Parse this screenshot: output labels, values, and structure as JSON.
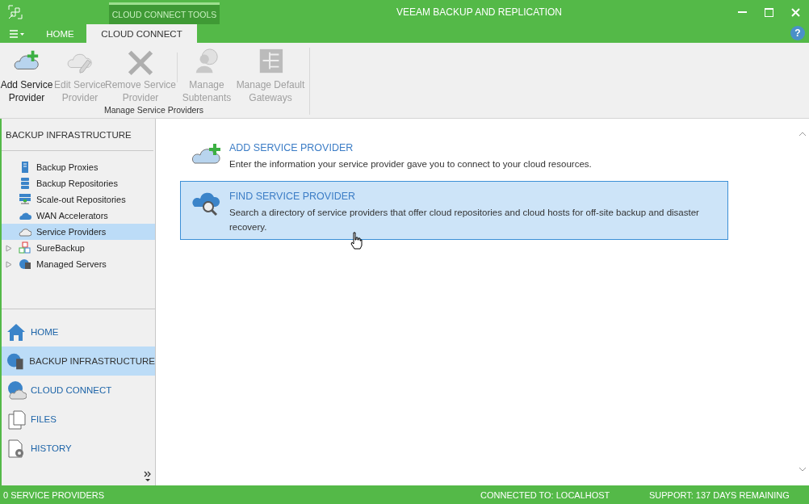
{
  "window": {
    "title": "VEEAM BACKUP AND REPLICATION",
    "context_tab": "CLOUD CONNECT TOOLS"
  },
  "tabs": [
    {
      "label": "HOME",
      "selected": false
    },
    {
      "label": "CLOUD CONNECT",
      "selected": true
    }
  ],
  "ribbon": {
    "groups": [
      {
        "label": "Manage Service Providers",
        "buttons": [
          {
            "label": "Add Service Provider",
            "disabled": false
          },
          {
            "label": "Edit Service Provider",
            "disabled": true
          },
          {
            "label": "Remove Service Provider",
            "disabled": true
          },
          {
            "label": "Manage Subtenants",
            "disabled": true
          },
          {
            "label": "Manage Default Gateways",
            "disabled": true
          }
        ]
      }
    ]
  },
  "sidebar": {
    "title": "BACKUP INFRASTRUCTURE",
    "items": [
      {
        "label": "Backup Proxies",
        "expandable": false,
        "selected": false
      },
      {
        "label": "Backup Repositories",
        "expandable": false,
        "selected": false
      },
      {
        "label": "Scale-out Repositories",
        "expandable": false,
        "selected": false
      },
      {
        "label": "WAN Accelerators",
        "expandable": false,
        "selected": false
      },
      {
        "label": "Service Providers",
        "expandable": false,
        "selected": true
      },
      {
        "label": "SureBackup",
        "expandable": true,
        "selected": false
      },
      {
        "label": "Managed Servers",
        "expandable": true,
        "selected": false
      }
    ],
    "nav": [
      {
        "label": "HOME",
        "selected": false
      },
      {
        "label": "BACKUP INFRASTRUCTURE",
        "selected": true
      },
      {
        "label": "CLOUD CONNECT",
        "selected": false
      },
      {
        "label": "FILES",
        "selected": false
      },
      {
        "label": "HISTORY",
        "selected": false
      }
    ]
  },
  "cards": [
    {
      "title": "ADD SERVICE PROVIDER",
      "description": "Enter the information your service provider gave you to connect to your cloud resources.",
      "selected": false
    },
    {
      "title": "FIND SERVICE PROVIDER",
      "description": "Search a directory of service providers that offer cloud repositories and cloud hosts for off-site backup and disaster recovery.",
      "selected": true
    }
  ],
  "status_bar": {
    "left": "0 SERVICE PROVIDERS",
    "connection": "CONNECTED TO: LOCALHOST",
    "support": "SUPPORT: 137 DAYS REMAINING"
  },
  "help": "?"
}
